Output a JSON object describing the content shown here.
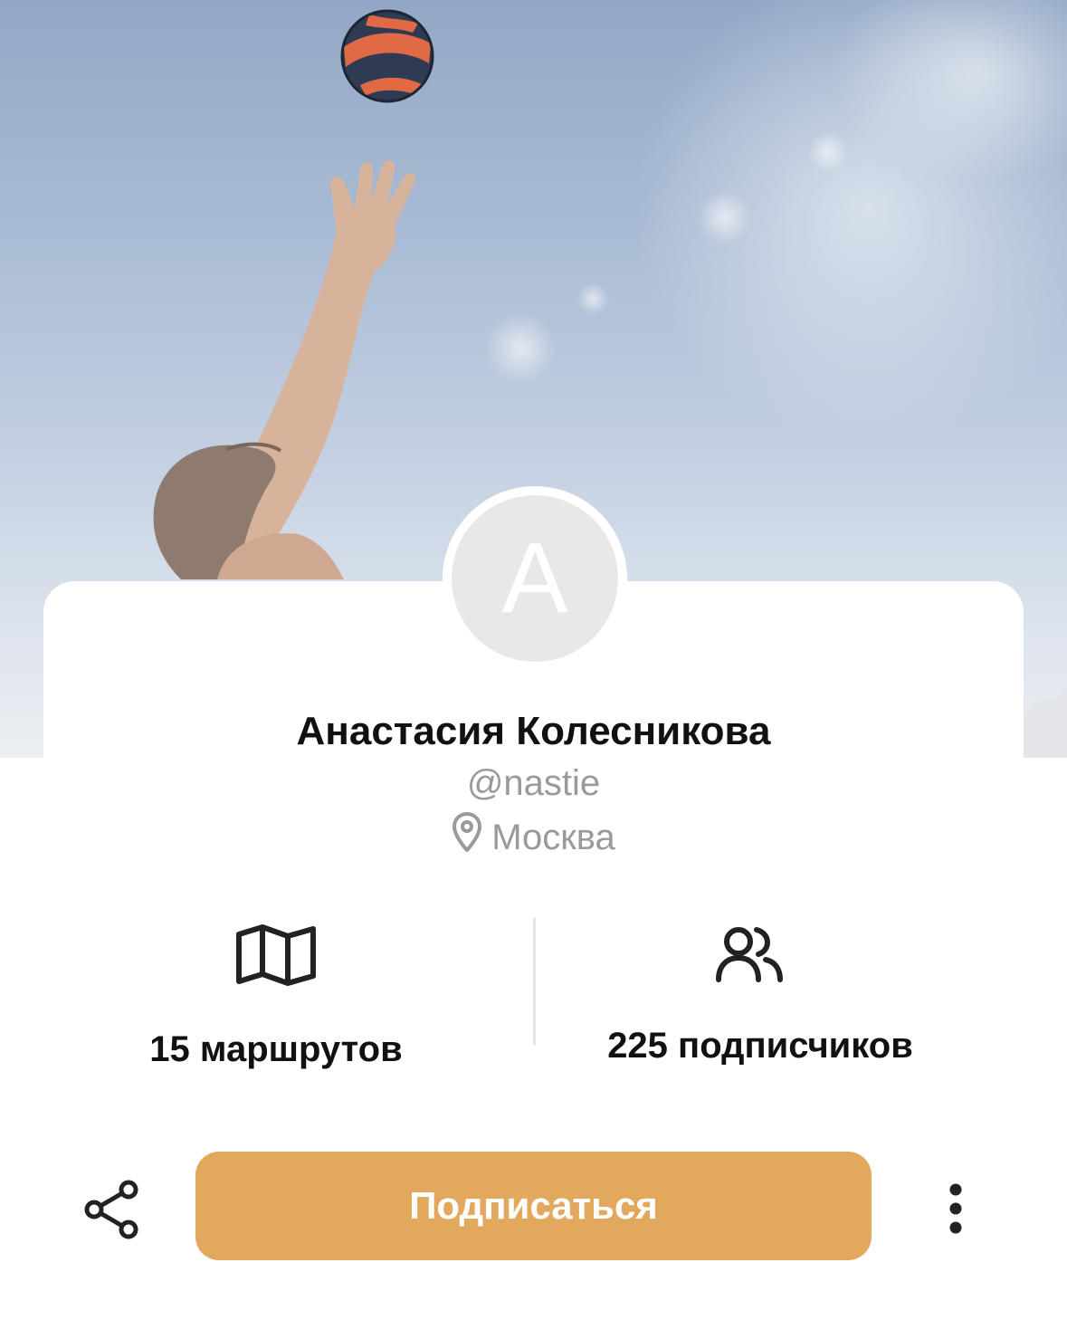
{
  "profile": {
    "avatar_initial": "A",
    "name": "Анастасия Колесникова",
    "handle": "@nastie",
    "location": "Москва"
  },
  "stats": {
    "routes_label": "15 маршрутов",
    "followers_label": "225 подписчиков"
  },
  "actions": {
    "subscribe_label": "Подписаться"
  },
  "icons": {
    "location": "map-pin-icon",
    "routes": "map-icon",
    "followers": "users-icon",
    "share": "share-icon",
    "more": "more-vertical-icon"
  },
  "colors": {
    "accent": "#e2a95e",
    "text_primary": "#111111",
    "text_secondary": "#9a9a9a",
    "avatar_bg": "#e8e8e8"
  }
}
